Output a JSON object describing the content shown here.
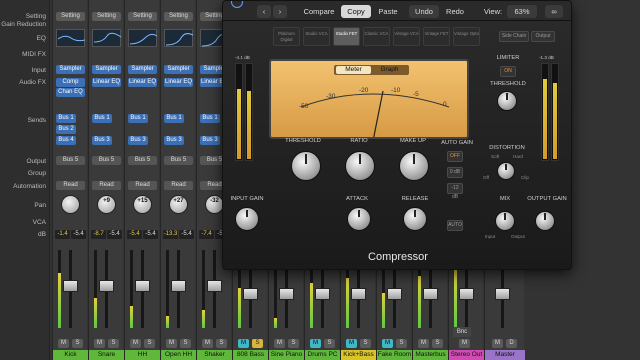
{
  "row_labels": {
    "setting": "Setting",
    "gain_reduction": "Gain Reduction",
    "eq": "EQ",
    "midi_fx": "MIDI FX",
    "input": "Input",
    "audio_fx": "Audio FX",
    "sends": "Sends",
    "output": "Output",
    "group": "Group",
    "automation": "Automation",
    "pan": "Pan",
    "vca": "VCA",
    "db": "dB"
  },
  "strips": [
    {
      "name": "Kick",
      "setting": "Setting",
      "input": "Sampler",
      "fx1": "Comp",
      "fx2": "Chan EQ",
      "send1": "Bus 1",
      "send2": "Bus 2",
      "send3": "Bus 4",
      "output": "Bus 5",
      "automation": "Read",
      "pan": "",
      "db_left": "-1.4",
      "db_right": "-5.4",
      "name_color": "#5fb83a"
    },
    {
      "name": "Snare",
      "setting": "Setting",
      "input": "Sampler",
      "fx1": "Linear EQ",
      "fx2": "",
      "send1": "Bus 1",
      "send2": "",
      "send3": "Bus 3",
      "output": "Bus 5",
      "automation": "Read",
      "pan": "+9",
      "db_left": "-8.7",
      "db_right": "-5.4",
      "name_color": "#5fb83a"
    },
    {
      "name": "HH",
      "setting": "Setting",
      "input": "Sampler",
      "fx1": "Linear EQ",
      "fx2": "",
      "send1": "Bus 1",
      "send2": "",
      "send3": "Bus 3",
      "output": "Bus 5",
      "automation": "Read",
      "pan": "+15",
      "db_left": "-5.4",
      "db_right": "-5.4",
      "name_color": "#5fb83a"
    },
    {
      "name": "Open HH",
      "setting": "Setting",
      "input": "Sampler",
      "fx1": "Linear EQ",
      "fx2": "",
      "send1": "Bus 1",
      "send2": "",
      "send3": "Bus 3",
      "output": "Bus 5",
      "automation": "Read",
      "pan": "+27",
      "db_left": "-13.3",
      "db_right": "-5.4",
      "name_color": "#5fb83a"
    },
    {
      "name": "Shaker",
      "setting": "Setting",
      "input": "Sampler",
      "fx1": "Linear EQ",
      "fx2": "",
      "send1": "Bus 1",
      "send2": "",
      "send3": "Bus 3",
      "output": "Bus 5",
      "automation": "Read",
      "pan": "-32",
      "db_left": "-7.4",
      "db_right": "-5.4",
      "name_color": "#5fb83a"
    },
    {
      "name": "808 Bass",
      "name_color": "#5fb83a"
    },
    {
      "name": "Sine Piano",
      "name_color": "#5fb83a"
    },
    {
      "name": "Drums PC",
      "name_color": "#5fb83a"
    },
    {
      "name": "Kick+Bass",
      "name_color": "#d9c42a"
    },
    {
      "name": "Fake Room",
      "name_color": "#5fb83a"
    },
    {
      "name": "Masterbus",
      "name_color": "#5fb83a"
    },
    {
      "name": "Stereo Out",
      "name_color": "#d24bb4"
    },
    {
      "name": "Master",
      "name_color": "#9a74c9"
    }
  ],
  "strip_buttons": {
    "m": "M",
    "s": "S",
    "d": "D",
    "bnc": "Bnc"
  },
  "plugin": {
    "toolbar": {
      "compare": "Compare",
      "copy": "Copy",
      "paste": "Paste",
      "undo": "Undo",
      "redo": "Redo",
      "view_label": "View:",
      "view_value": "63%"
    },
    "models": [
      "Platinum Digital",
      "Studio VCA",
      "Studio FET",
      "Classic VCA",
      "Vintage VCA",
      "Vintage FET",
      "Vintage Opto"
    ],
    "side_buttons": {
      "sidechain": "Side Chain",
      "output": "Output"
    },
    "meter_graph": {
      "meter": "Meter",
      "graph": "Graph"
    },
    "vu_scale": [
      "-50",
      "-30",
      "-20",
      "-10",
      "-5",
      "0"
    ],
    "input_gain": {
      "label": "INPUT GAIN",
      "readout": "-4.1 dB"
    },
    "output_gain": {
      "label": "OUTPUT GAIN",
      "readout": "-1.3 dB"
    },
    "threshold": "THRESHOLD",
    "ratio": "RATIO",
    "makeup": "MAKE UP",
    "auto_gain": {
      "label": "AUTO GAIN",
      "off": "OFF",
      "opt1": "0 dB",
      "opt2": "-12 dB"
    },
    "attack": "ATTACK",
    "release": "RELEASE",
    "auto": "AUTO",
    "limiter": {
      "label": "LIMITER",
      "state": "ON",
      "threshold": "THRESHOLD"
    },
    "distortion": {
      "label": "DISTORTION",
      "soft": "Soft",
      "hard": "Hard",
      "off": "Off",
      "clip": "Clip"
    },
    "mix": {
      "label": "MIX",
      "input": "Input",
      "output": "Output"
    },
    "name": "Compressor"
  }
}
